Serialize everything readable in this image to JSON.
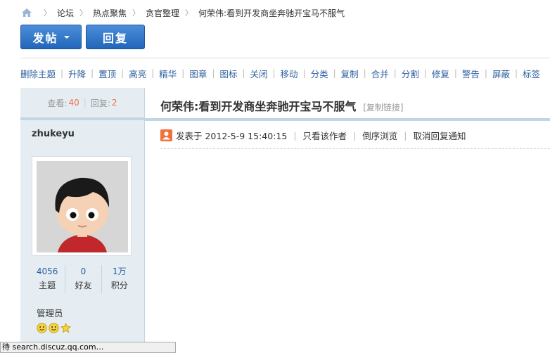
{
  "breadcrumb": {
    "items": [
      "论坛",
      "热点聚焦",
      "贪官整理",
      "何荣伟:看到开发商坐奔驰开宝马不服气"
    ]
  },
  "buttons": {
    "post": "发帖",
    "reply": "回复"
  },
  "mod_toolbar": [
    "删除主题",
    "升降",
    "置顶",
    "高亮",
    "精华",
    "图章",
    "图标",
    "关闭",
    "移动",
    "分类",
    "复制",
    "合并",
    "分割",
    "修复",
    "警告",
    "屏蔽",
    "标签"
  ],
  "thread_stats": {
    "views_label": "查看:",
    "views": "40",
    "replies_label": "回复:",
    "replies": "2"
  },
  "author": {
    "username": "zhukeyu",
    "stats": [
      {
        "value": "4056",
        "label": "主题"
      },
      {
        "value": "0",
        "label": "好友"
      },
      {
        "value": "1万",
        "label": "积分"
      }
    ],
    "role": "管理员",
    "medals": [
      "smiley-medal-icon",
      "smiley-medal-icon",
      "star-medal-icon"
    ]
  },
  "post": {
    "title": "何荣伟:看到开发商坐奔驰开宝马不服气",
    "copy_link": "[复制链接]",
    "posted": "发表于 2012-5-9 15:40:15",
    "only_author": "只看该作者",
    "reverse": "倒序浏览",
    "cancel_notify": "取消回复通知"
  },
  "status_bar": "待 search.discuz.qq.com…",
  "colors": {
    "accent": "#2b5e9e",
    "button": "#2a6bc0",
    "highlight": "#f26c4f",
    "sidebar": "#e5edf2"
  }
}
